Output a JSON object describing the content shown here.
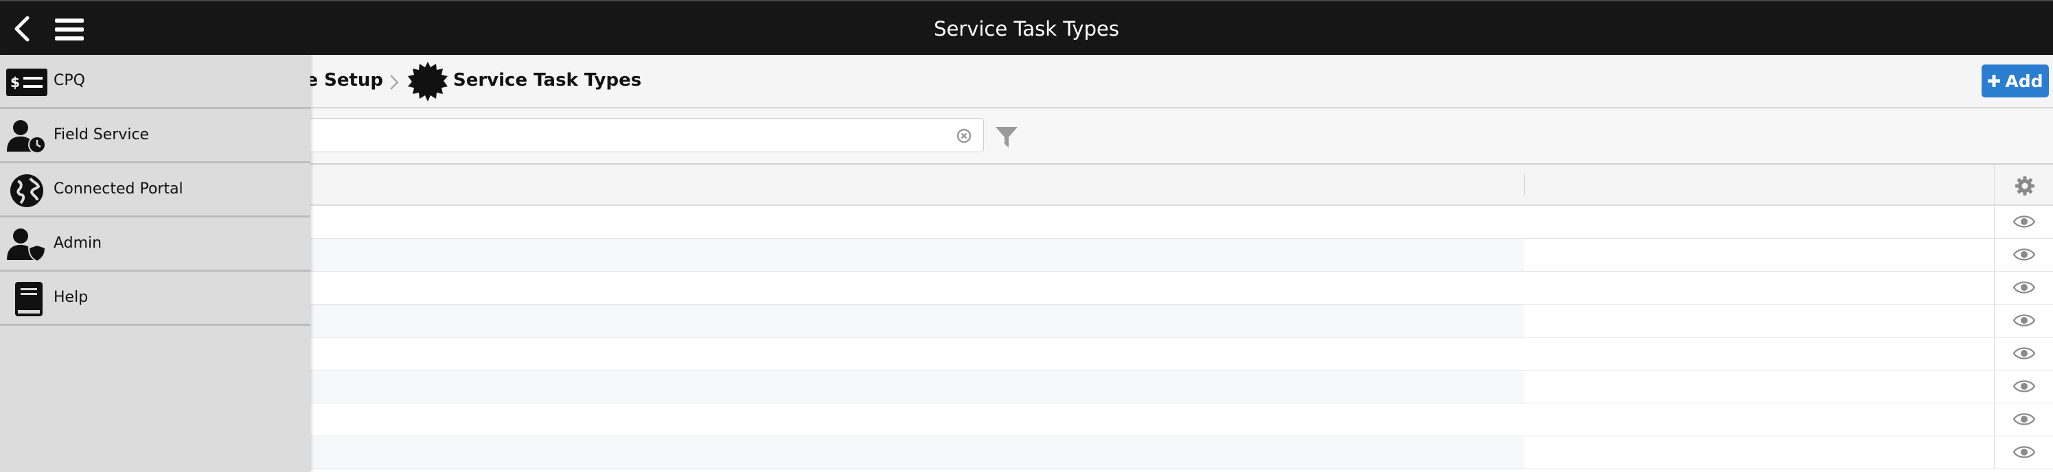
{
  "header": {
    "title": "Service Task Types",
    "back_icon": "chevron-left-icon",
    "menu_icon": "hamburger-icon"
  },
  "breadcrumb": {
    "parent": "ce Setup",
    "current": "Service Task Types",
    "badge_icon": "starburst-icon"
  },
  "toolbar": {
    "add_label": "Add",
    "add_icon": "plus-icon",
    "accent_color": "#2a7dd1"
  },
  "search": {
    "value": "",
    "placeholder": "",
    "clear_icon": "clear-circle-icon",
    "filter_icon": "filter-funnel-icon"
  },
  "table": {
    "settings_icon": "gear-icon",
    "row_action_icon": "eye-icon",
    "rows": [
      "",
      "",
      "",
      "",
      "",
      "",
      "",
      ""
    ]
  },
  "sidemenu": {
    "items": [
      {
        "label": "CPQ",
        "icon": "cpq-price-icon"
      },
      {
        "label": "Field Service",
        "icon": "field-service-user-clock-icon"
      },
      {
        "label": "Connected Portal",
        "icon": "globe-icon"
      },
      {
        "label": "Admin",
        "icon": "admin-user-shield-icon"
      },
      {
        "label": "Help",
        "icon": "help-book-icon"
      }
    ]
  }
}
